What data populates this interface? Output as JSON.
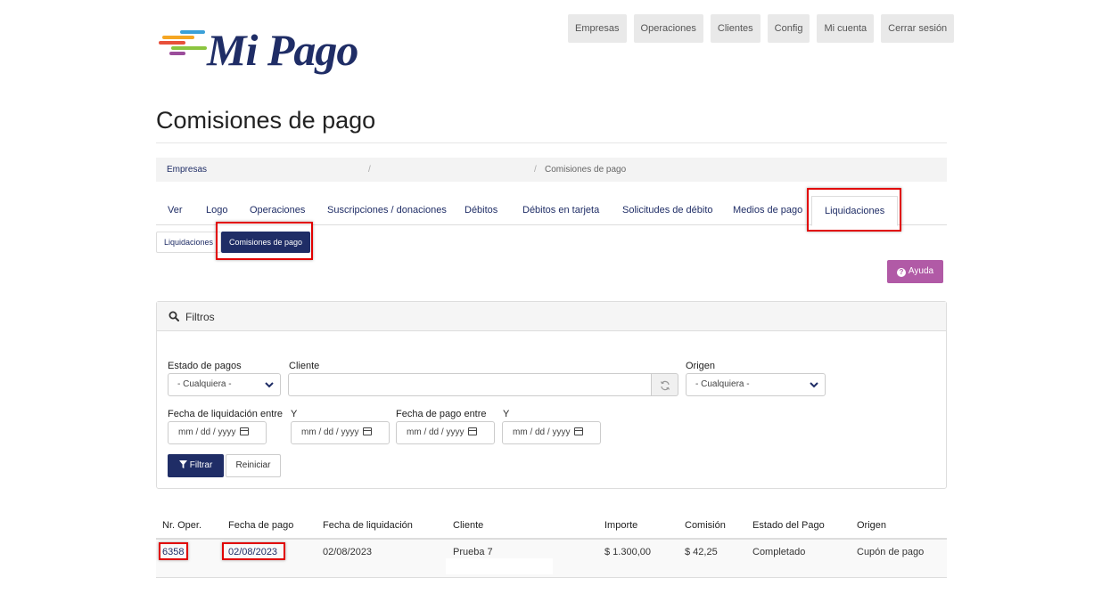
{
  "logo": {
    "text": "Mi Pago",
    "colors": [
      "#e8503a",
      "#f5a623",
      "#3aa0d8",
      "#8bc53f",
      "#9b4d9b"
    ]
  },
  "topnav": [
    "Empresas",
    "Operaciones",
    "Clientes",
    "Config",
    "Mi cuenta",
    "Cerrar sesión"
  ],
  "page_title": "Comisiones de pago",
  "breadcrumb": {
    "root": "Empresas",
    "sep": "/",
    "current": "Comisiones de pago"
  },
  "tabs": [
    "Ver",
    "Logo",
    "Operaciones",
    "Suscripciones / donaciones",
    "Débitos",
    "Débitos en tarjeta",
    "Solicitudes de débito",
    "Medios de pago",
    "Liquidaciones"
  ],
  "subtabs": [
    "Liquidaciones",
    "Comisiones de pago"
  ],
  "help_label": "Ayuda",
  "filters": {
    "title": "Filtros",
    "estado_label": "Estado de pagos",
    "estado_value": "- Cualquiera -",
    "cliente_label": "Cliente",
    "origen_label": "Origen",
    "origen_value": "- Cualquiera -",
    "fecha_liq_label": "Fecha de liquidación entre",
    "y_label": "Y",
    "fecha_pago_label": "Fecha de pago entre",
    "date_placeholder": "mm / dd / yyyy",
    "filter_button": "Filtrar",
    "reset_button": "Reinicia r"
  },
  "table": {
    "headers": [
      "Nr. Oper.",
      "Fecha de pago",
      "Fecha de liquidación",
      "Cliente",
      "Importe",
      "Comisión",
      "Estado del Pago",
      "Origen"
    ],
    "rows": [
      [
        "6358",
        "02/08/2023",
        "02/08/2023",
        "Prueba 7",
        "$ 1.300,00",
        "$ 42,25",
        "Completado",
        "Cupón de pago"
      ]
    ]
  },
  "accent_colors": {
    "primary": "#1f2d66",
    "help": "#b15aa6",
    "highlight": "#e10000"
  }
}
